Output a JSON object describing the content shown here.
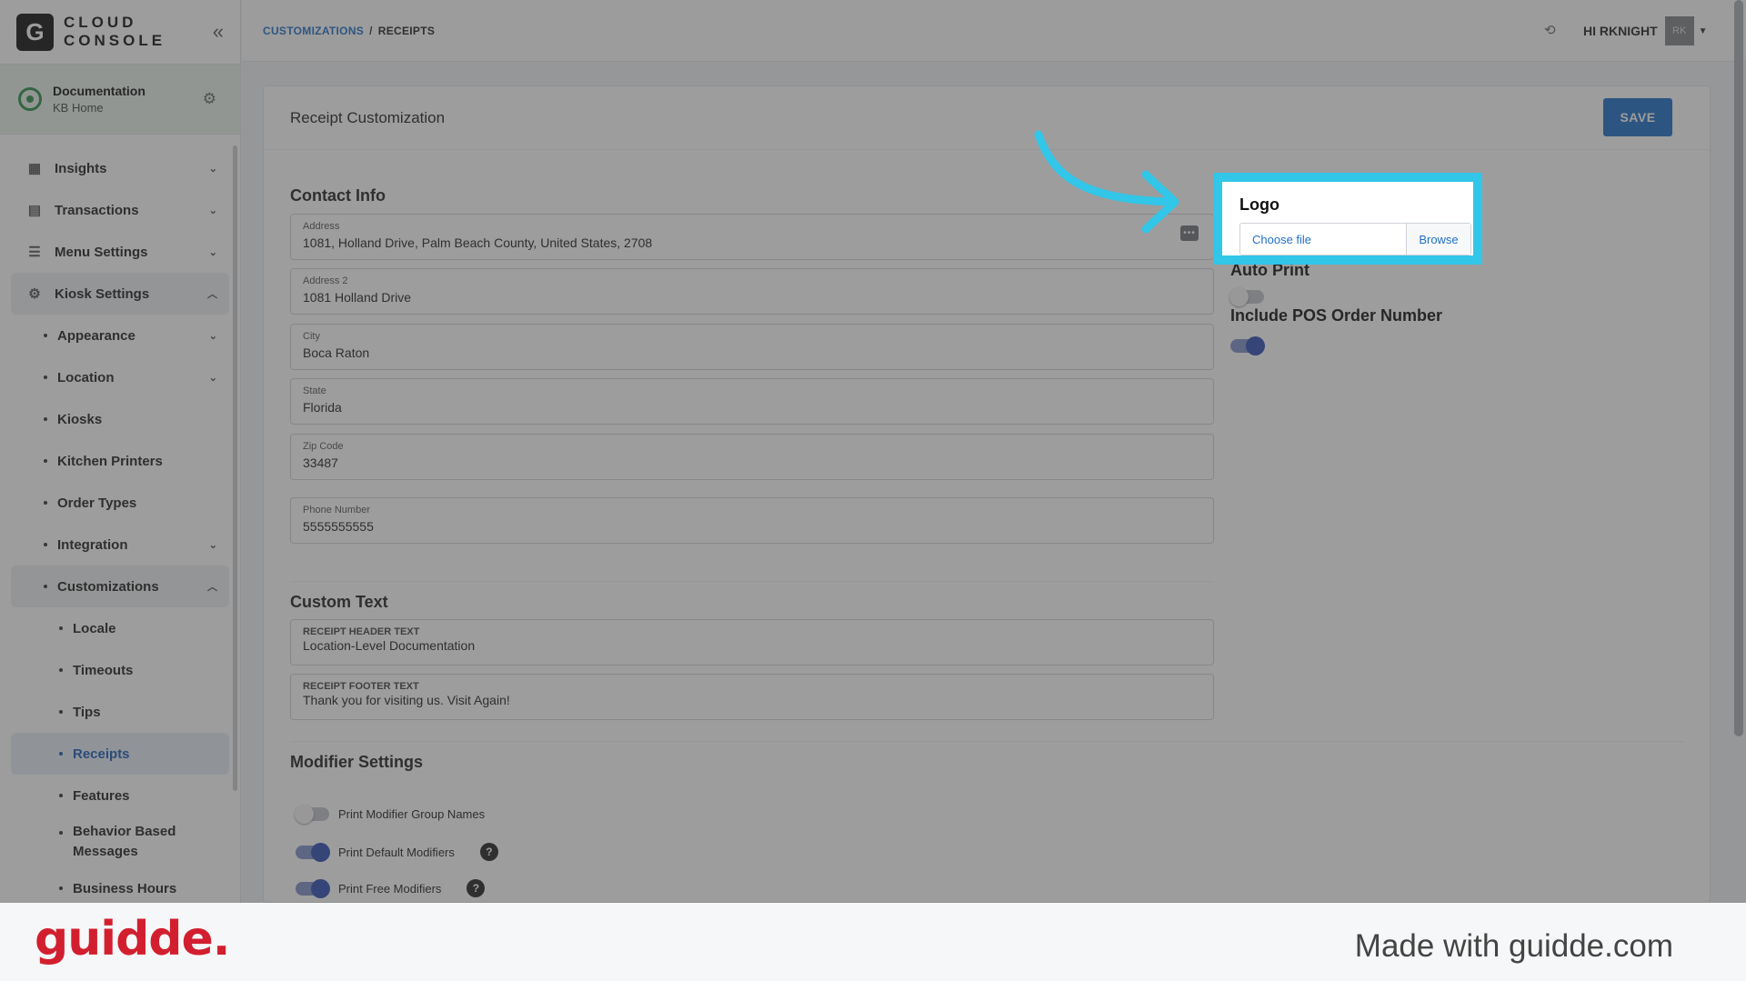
{
  "brand": {
    "letter": "G",
    "line1": "CLOUD",
    "line2": "CONSOLE"
  },
  "location": {
    "title": "Documentation",
    "subtitle": "KB Home"
  },
  "sidebar": {
    "items": [
      {
        "label": "Insights"
      },
      {
        "label": "Transactions"
      },
      {
        "label": "Menu Settings"
      },
      {
        "label": "Kiosk Settings"
      }
    ],
    "kiosk_sub": [
      {
        "label": "Appearance"
      },
      {
        "label": "Location"
      },
      {
        "label": "Kiosks"
      },
      {
        "label": "Kitchen Printers"
      },
      {
        "label": "Order Types"
      },
      {
        "label": "Integration"
      },
      {
        "label": "Customizations"
      }
    ],
    "custom_sub": [
      {
        "label": "Locale"
      },
      {
        "label": "Timeouts"
      },
      {
        "label": "Tips"
      },
      {
        "label": "Receipts"
      },
      {
        "label": "Features"
      },
      {
        "label": "Behavior Based Messages"
      },
      {
        "label": "Business Hours"
      }
    ]
  },
  "topbar": {
    "crumb_parent": "CUSTOMIZATIONS",
    "crumb_sep": "/",
    "crumb_current": "RECEIPTS",
    "user_greeting": "HI RKNIGHT",
    "avatar_initials": "RK"
  },
  "page": {
    "title": "Receipt Customization",
    "save_label": "SAVE"
  },
  "contact": {
    "section_title": "Contact Info",
    "fields": [
      {
        "label": "Address",
        "value": "1081, Holland Drive, Palm Beach County, United States, 2708"
      },
      {
        "label": "Address 2",
        "value": "1081 Holland Drive"
      },
      {
        "label": "City",
        "value": "Boca Raton"
      },
      {
        "label": "State",
        "value": "Florida"
      },
      {
        "label": "Zip Code",
        "value": "33487"
      },
      {
        "label": "Phone Number",
        "value": "5555555555"
      }
    ]
  },
  "custom_text": {
    "section_title": "Custom Text",
    "fields": [
      {
        "label": "RECEIPT HEADER TEXT",
        "value": "Location-Level Documentation"
      },
      {
        "label": "RECEIPT FOOTER TEXT",
        "value": "Thank you for visiting us. Visit Again!"
      }
    ]
  },
  "right": {
    "logo_title": "Logo",
    "file_placeholder": "Choose file",
    "browse_label": "Browse",
    "auto_print_label": "Auto Print",
    "auto_print_on": false,
    "pos_number_label": "Include POS Order Number",
    "pos_number_on": true
  },
  "modifiers": {
    "section_title": "Modifier Settings",
    "rows": [
      {
        "label": "Print Modifier Group Names",
        "on": false,
        "help": false
      },
      {
        "label": "Print Default Modifiers",
        "on": true,
        "help": true
      },
      {
        "label": "Print Free Modifiers",
        "on": true,
        "help": true
      }
    ],
    "help_symbol": "?"
  },
  "footer": {
    "logo": "guidde.",
    "tagline": "Made with guidde.com"
  },
  "colors": {
    "accent": "#1f6fc6",
    "highlight": "#32c6e8",
    "toggle_on": "#2f4fb5",
    "guidde_red": "#d21f2f"
  },
  "icons": [
    "collapse-icon",
    "location-pin-icon",
    "gear-icon",
    "insights-icon",
    "transactions-icon",
    "menu-settings-icon",
    "kiosk-settings-icon",
    "chevron-down-icon",
    "chevron-up-icon",
    "refresh-icon",
    "caret-down-icon",
    "more-dots-icon",
    "help-icon",
    "arrow-pointer-icon"
  ]
}
